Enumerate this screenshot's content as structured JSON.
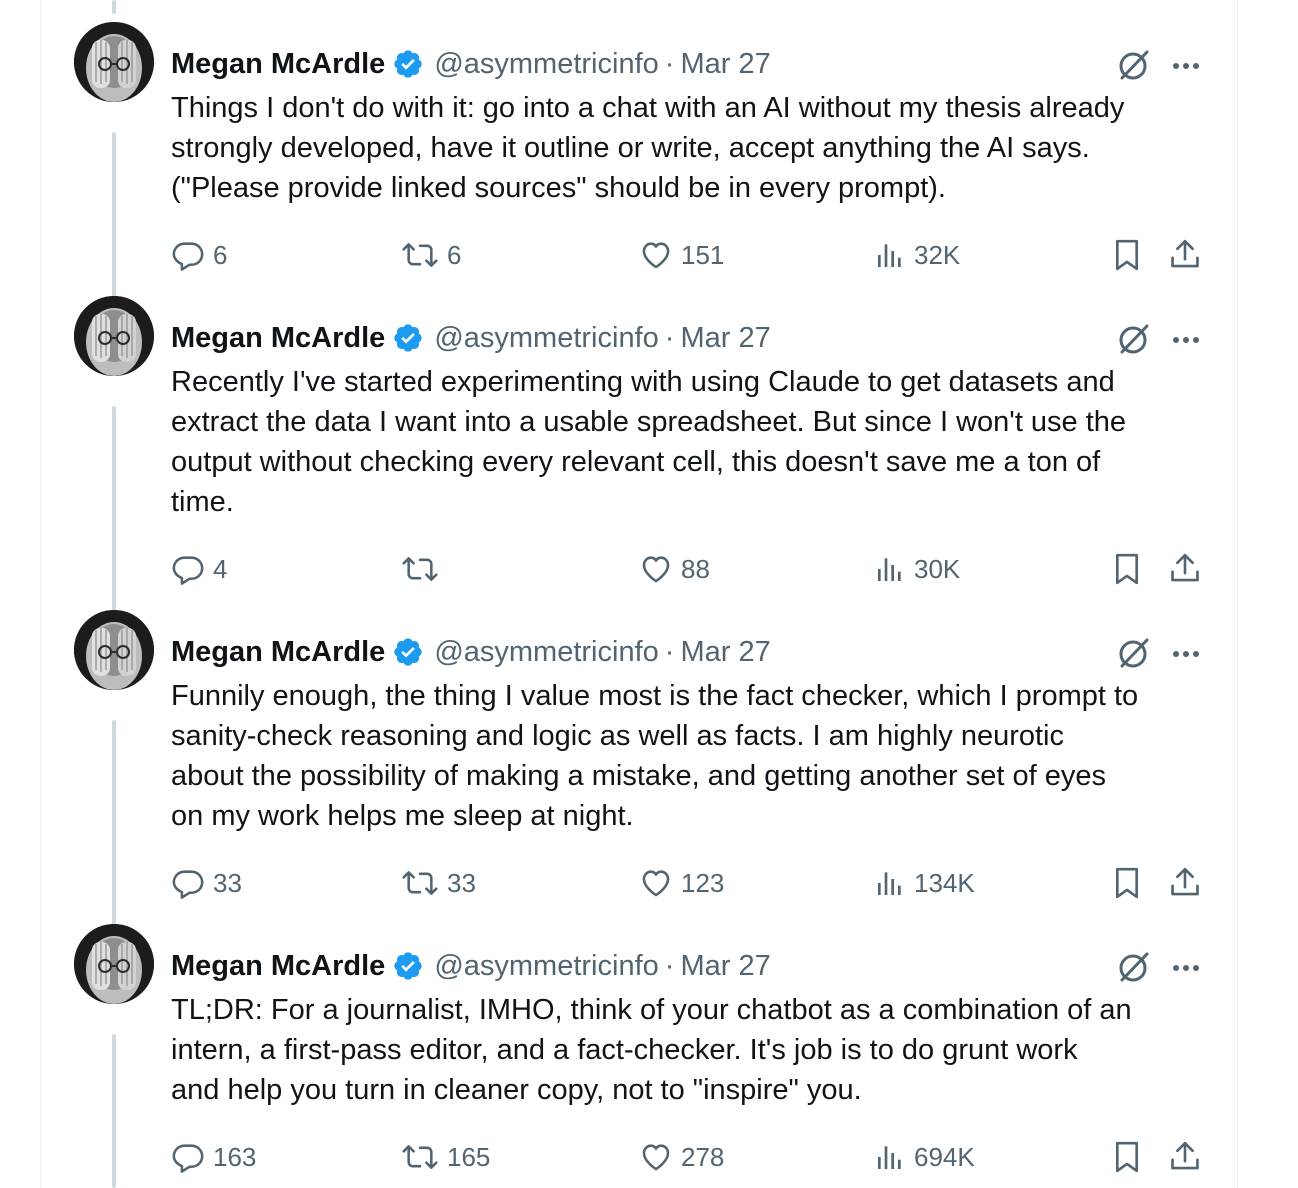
{
  "tweets": [
    {
      "author": "Megan McArdle",
      "handle": "@asymmetricinfo",
      "separator": "·",
      "date": "Mar 27",
      "text": "Things I don't do with it: go into a chat with an AI without my thesis already\nstrongly developed, have it outline or write, accept anything the AI says.\n(\"Please provide linked sources\" should be in every prompt).",
      "replies": "6",
      "reposts": "6",
      "likes": "151",
      "views": "32K"
    },
    {
      "author": "Megan McArdle",
      "handle": "@asymmetricinfo",
      "separator": "·",
      "date": "Mar 27",
      "text": "Recently I've started experimenting with using Claude to get datasets and\nextract the data I want into a usable spreadsheet. But since I won't use the\noutput without checking every relevant cell, this doesn't save me a ton of\ntime.",
      "replies": "4",
      "reposts": "",
      "likes": "88",
      "views": "30K"
    },
    {
      "author": "Megan McArdle",
      "handle": "@asymmetricinfo",
      "separator": "·",
      "date": "Mar 27",
      "text": "Funnily enough, the thing I value most is the fact checker, which I prompt to\nsanity-check reasoning and logic as well as facts. I am highly neurotic\nabout the possibility of making a mistake, and getting another set of eyes\non my work helps me sleep at night.",
      "replies": "33",
      "reposts": "33",
      "likes": "123",
      "views": "134K"
    },
    {
      "author": "Megan McArdle",
      "handle": "@asymmetricinfo",
      "separator": "·",
      "date": "Mar 27",
      "text": "TL;DR: For a journalist, IMHO, think of your chatbot as a combination of an\nintern, a first-pass editor, and a fact-checker. It's job is to do grunt work\nand help you turn in cleaner copy, not to \"inspire\" you.",
      "replies": "163",
      "reposts": "165",
      "likes": "278",
      "views": "694K"
    }
  ],
  "colors": {
    "text": "#0f1419",
    "secondary": "#536471",
    "verified": "#1d9bf0",
    "thread_line": "#cfd9de"
  },
  "icons": [
    "verified-badge-icon",
    "grok-icon",
    "more-icon",
    "reply-icon",
    "repost-icon",
    "like-icon",
    "views-icon",
    "bookmark-icon",
    "share-icon"
  ]
}
